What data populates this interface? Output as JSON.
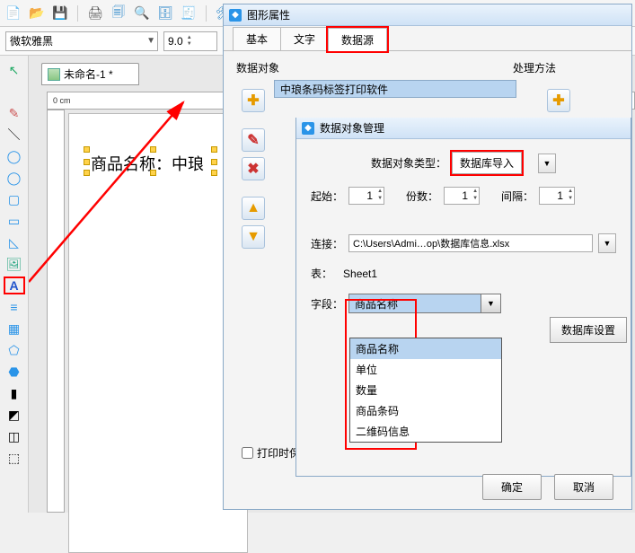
{
  "toolbar": {
    "icons": [
      "📄",
      "📂",
      "💾",
      "",
      "🖨",
      "📋",
      "🔍",
      "🗄",
      "📊",
      "",
      "⚙"
    ]
  },
  "font_bar": {
    "font_name": "微软雅黑",
    "font_size": "9.0"
  },
  "doc_tab": {
    "title": "未命名-1 *"
  },
  "ruler": {
    "label": "0 cm"
  },
  "canvas": {
    "text": "商品名称：中琅"
  },
  "tools": [
    "↖",
    "",
    "✏",
    "＼",
    "◯",
    "◯",
    "▭",
    "▭",
    "▲",
    "🖼",
    "A",
    "≡",
    "▦",
    "⬠",
    "⬣",
    "—",
    "◯",
    "◫",
    "⬚"
  ],
  "prop_panel": {
    "title": "图形属性",
    "tabs": [
      "基本",
      "文字",
      "数据源"
    ],
    "left_section": "数据对象",
    "right_section": "处理方法",
    "data_list_item": "中琅条码标签打印软件",
    "print_save": "打印时保付"
  },
  "dlg": {
    "title": "数据对象管理",
    "type_label": "数据对象类型：",
    "type_value": "数据库导入",
    "start_label": "起始：",
    "start_value": "1",
    "copies_label": "份数：",
    "copies_value": "1",
    "gap_label": "间隔：",
    "gap_value": "1",
    "conn_label": "连接：",
    "conn_value": "C:\\Users\\Admi…op\\数据库信息.xlsx",
    "sheet_label": "表：",
    "sheet_value": "Sheet1",
    "field_label": "字段：",
    "field_value": "商品名称",
    "field_options": [
      "商品名称",
      "单位",
      "数量",
      "商品条码",
      "二维码信息"
    ],
    "db_settings": "数据库设置"
  },
  "footer": {
    "ok": "确定",
    "cancel": "取消"
  }
}
